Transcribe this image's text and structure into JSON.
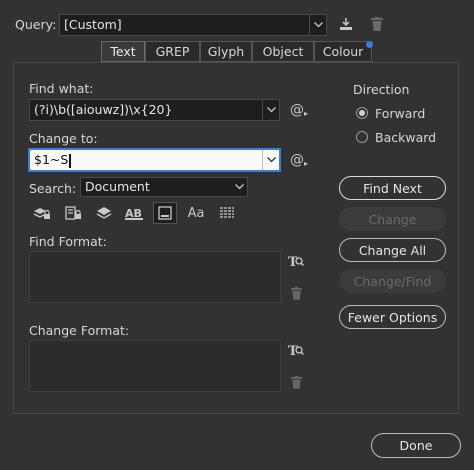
{
  "query": {
    "label": "Query:",
    "value": "[Custom]"
  },
  "tabs": [
    "Text",
    "GREP",
    "Glyph",
    "Object",
    "Colour"
  ],
  "find_what": {
    "label": "Find what:",
    "value": "(?i)\\b([aiouwz])\\x{20}"
  },
  "change_to": {
    "label": "Change to:",
    "value": "$1~S"
  },
  "search": {
    "label": "Search:",
    "value": "Document"
  },
  "find_format": {
    "label": "Find Format:"
  },
  "change_format": {
    "label": "Change Format:"
  },
  "direction": {
    "title": "Direction",
    "options": [
      "Forward",
      "Backward"
    ],
    "selected": "Forward"
  },
  "buttons": {
    "find_next": "Find Next",
    "change": "Change",
    "change_all": "Change All",
    "change_find": "Change/Find",
    "fewer_options": "Fewer Options",
    "done": "Done"
  },
  "colors": {
    "accent": "#3c7be0",
    "background": "#323232"
  },
  "icons": [
    "save-query-icon",
    "delete-query-icon",
    "special-characters-icon",
    "lock-layers-icon",
    "lock-stories-icon",
    "include-hidden-layers-icon",
    "include-master-pages-icon",
    "include-footnotes-icon",
    "case-sensitive-icon",
    "whole-word-icon",
    "specify-attributes-icon",
    "clear-attributes-icon"
  ]
}
